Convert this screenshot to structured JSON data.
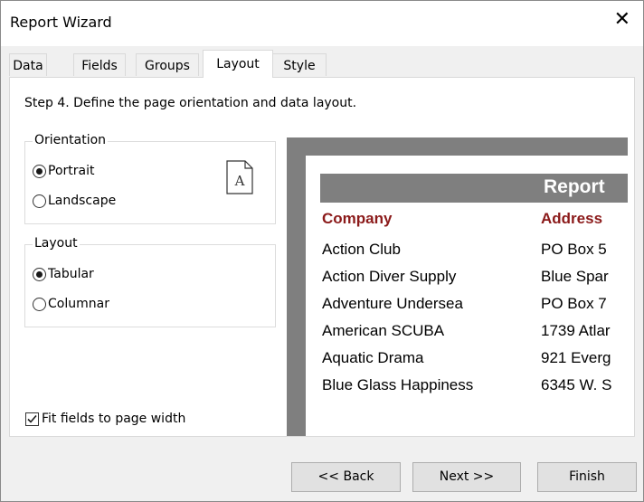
{
  "window": {
    "title": "Report Wizard",
    "close_glyph": "✕"
  },
  "tabs": [
    {
      "label": "Data",
      "active": false
    },
    {
      "label": "Fields",
      "active": false
    },
    {
      "label": "Groups",
      "active": false
    },
    {
      "label": "Layout",
      "active": true
    },
    {
      "label": "Style",
      "active": false
    }
  ],
  "step_text": "Step 4. Define the page orientation and data layout.",
  "orientation": {
    "legend": "Orientation",
    "options": [
      {
        "label": "Portrait",
        "selected": true
      },
      {
        "label": "Landscape",
        "selected": false
      }
    ],
    "icon": "page-portrait-icon",
    "icon_letter": "A"
  },
  "layout": {
    "legend": "Layout",
    "options": [
      {
        "label": "Tabular",
        "selected": true
      },
      {
        "label": "Columnar",
        "selected": false
      }
    ]
  },
  "fit_fields": {
    "label": "Fit fields to page width",
    "checked": true
  },
  "preview": {
    "title": "Report",
    "columns": [
      "Company",
      "Address"
    ],
    "rows": [
      [
        "Action Club",
        "PO Box 5"
      ],
      [
        "Action Diver Supply",
        "Blue Spar"
      ],
      [
        "Adventure Undersea",
        "PO Box 7"
      ],
      [
        "American SCUBA",
        "1739 Atlar"
      ],
      [
        "Aquatic Drama",
        "921 Everg"
      ],
      [
        "Blue Glass Happiness",
        "6345 W. S"
      ]
    ],
    "header_color": "#8b1a1a"
  },
  "buttons": {
    "back": "<< Back",
    "next": "Next >>",
    "finish": "Finish"
  }
}
